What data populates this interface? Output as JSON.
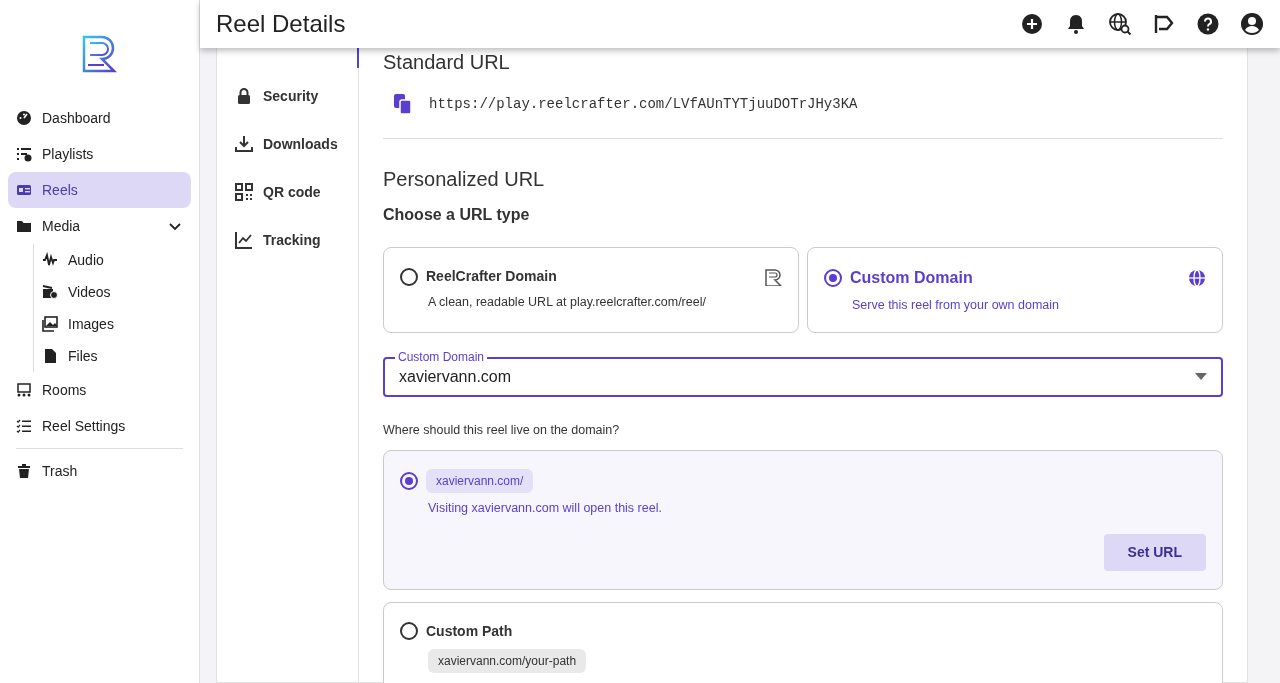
{
  "sidebar": {
    "items": [
      {
        "label": "Dashboard",
        "selected": false
      },
      {
        "label": "Playlists",
        "selected": false
      },
      {
        "label": "Reels",
        "selected": true
      },
      {
        "label": "Media",
        "selected": false,
        "expanded": true,
        "children": [
          {
            "label": "Audio",
            "selected": false
          },
          {
            "label": "Videos",
            "selected": false
          },
          {
            "label": "Images",
            "selected": false
          },
          {
            "label": "Files",
            "selected": false
          }
        ]
      },
      {
        "label": "Rooms",
        "selected": false
      },
      {
        "label": "Reel Settings",
        "selected": false
      }
    ],
    "footer_items": [
      {
        "label": "Trash",
        "selected": false
      }
    ]
  },
  "header": {
    "title": "Reel Details"
  },
  "subnav": {
    "items": [
      {
        "label": "Security",
        "selected": false
      },
      {
        "label": "Downloads",
        "selected": false
      },
      {
        "label": "QR code",
        "selected": false
      },
      {
        "label": "Tracking",
        "selected": false
      }
    ]
  },
  "standard_url": {
    "heading": "Standard URL",
    "url": "https://play.reelcrafter.com/LVfAUnTYTjuuDOTrJHy3KA"
  },
  "personalized_url": {
    "heading": "Personalized URL",
    "subheading": "Choose a URL type",
    "url_types": [
      {
        "title": "ReelCrafter Domain",
        "description": "A clean, readable URL at play.reelcrafter.com/reel/",
        "selected": false
      },
      {
        "title": "Custom Domain",
        "description": "Serve this reel from your own domain",
        "selected": true
      }
    ],
    "domain_select": {
      "label": "Custom Domain",
      "value": "xaviervann.com"
    },
    "location_prompt": "Where should this reel live on the domain?",
    "locations": [
      {
        "chip": "xaviervann.com/",
        "description": "Visiting xaviervann.com will open this reel.",
        "button": "Set URL",
        "selected": true
      },
      {
        "title": "Custom Path",
        "chip": "xaviervann.com/your-path",
        "selected": false
      }
    ]
  }
}
